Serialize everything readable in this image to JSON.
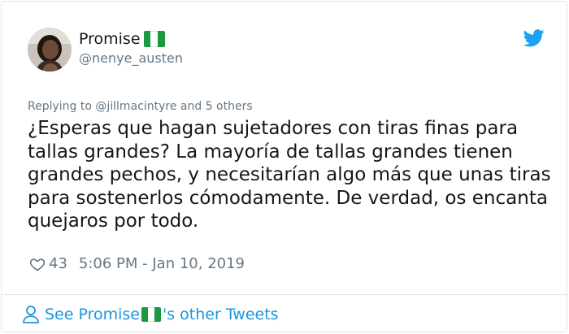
{
  "author": {
    "name": "Promise",
    "handle": "@nenye_austen"
  },
  "reply_context": "Replying to @jillmacintyre and 5 others",
  "tweet": {
    "text": "¿Esperas que hagan sujetadores con tiras finas para tallas grandes? La mayoría de tallas grandes tienen grandes pechos, y necesitarían algo más que unas tiras para sostenerlos cómodamente. De verdad, os encanta quejaros por todo.",
    "likes": "43",
    "timestamp": "5:06 PM - Jan 10, 2019"
  },
  "footer": {
    "prefix": "See Promise",
    "suffix": "'s other Tweets"
  },
  "icons": {
    "brand": "twitter-bird-icon",
    "like": "heart-icon",
    "profile": "person-icon",
    "flag": "nigeria-flag-icon"
  },
  "colors": {
    "link_blue": "#1b95e0",
    "twitter_blue": "#1da1f2",
    "muted_gray": "#657786",
    "text": "#14171a",
    "flag_green": "#1a9a3e"
  }
}
